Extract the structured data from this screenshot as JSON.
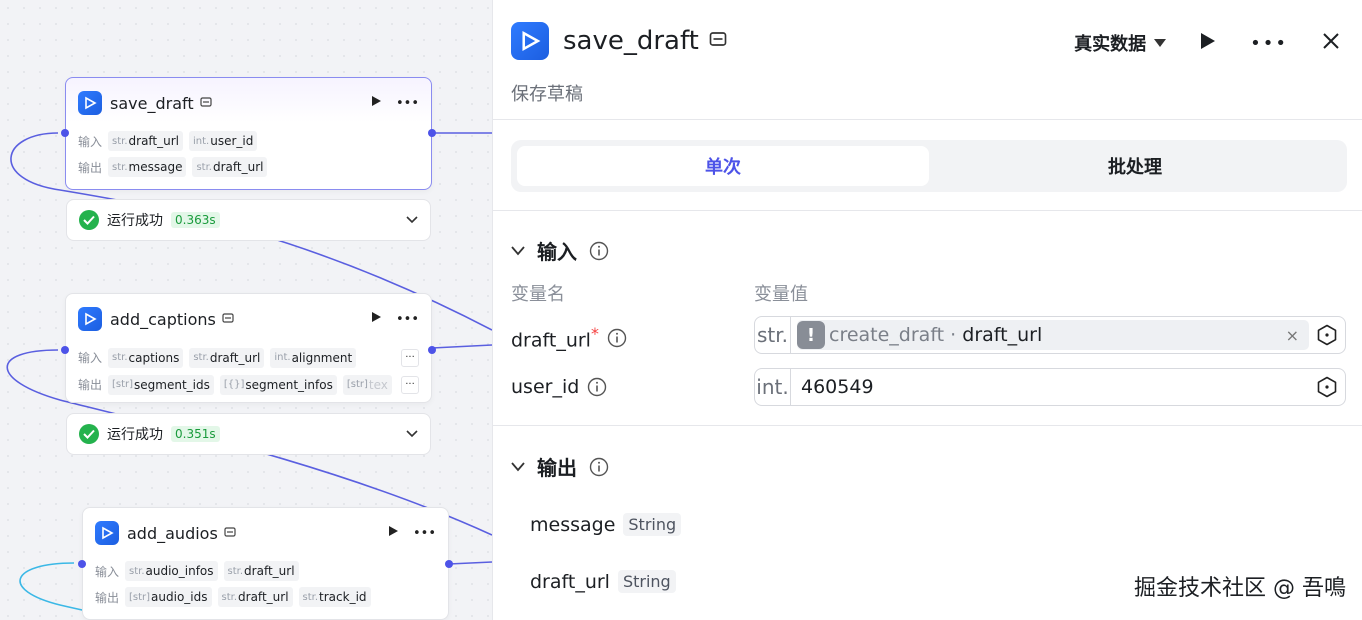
{
  "nodes": [
    {
      "title": "save_draft",
      "inputs_label": "输入",
      "outputs_label": "输出",
      "inputs": [
        {
          "type": "str.",
          "name": "draft_url"
        },
        {
          "type": "int.",
          "name": "user_id"
        }
      ],
      "outputs": [
        {
          "type": "str.",
          "name": "message"
        },
        {
          "type": "str.",
          "name": "draft_url"
        }
      ],
      "status": "运行成功",
      "time": "0.363s"
    },
    {
      "title": "add_captions",
      "inputs_label": "输入",
      "outputs_label": "输出",
      "inputs": [
        {
          "type": "str.",
          "name": "captions"
        },
        {
          "type": "str.",
          "name": "draft_url"
        },
        {
          "type": "int.",
          "name": "alignment"
        }
      ],
      "outputs": [
        {
          "type": "[str]",
          "name": "segment_ids"
        },
        {
          "type": "[{}]",
          "name": "segment_infos"
        },
        {
          "type": "[str]",
          "name": "tex"
        }
      ],
      "more": "···",
      "status": "运行成功",
      "time": "0.351s"
    },
    {
      "title": "add_audios",
      "inputs_label": "输入",
      "outputs_label": "输出",
      "inputs": [
        {
          "type": "str.",
          "name": "audio_infos"
        },
        {
          "type": "str.",
          "name": "draft_url"
        }
      ],
      "outputs": [
        {
          "type": "[str]",
          "name": "audio_ids"
        },
        {
          "type": "str.",
          "name": "draft_url"
        },
        {
          "type": "str.",
          "name": "track_id"
        }
      ]
    }
  ],
  "panel": {
    "title": "save_draft",
    "description": "保存草稿",
    "mode": "真实数据",
    "tabs": [
      "单次",
      "批处理"
    ],
    "input_section": "输入",
    "col_name": "变量名",
    "col_value": "变量值",
    "inputs": [
      {
        "name": "draft_url",
        "required": "*",
        "type": "str.",
        "ref_source": "create_draft",
        "ref_sep": " · ",
        "ref_var": "draft_url",
        "clear": "×"
      },
      {
        "name": "user_id",
        "type": "int.",
        "value": "460549"
      }
    ],
    "output_section": "输出",
    "outputs": [
      {
        "name": "message",
        "type": "String"
      },
      {
        "name": "draft_url",
        "type": "String"
      }
    ]
  },
  "watermark": "掘金技术社区 @ 吾鳴",
  "colors": {
    "accent": "#4d53e8",
    "success": "#24b24d",
    "required": "#f53f3f",
    "wire_cyan": "#3bb8e6"
  }
}
